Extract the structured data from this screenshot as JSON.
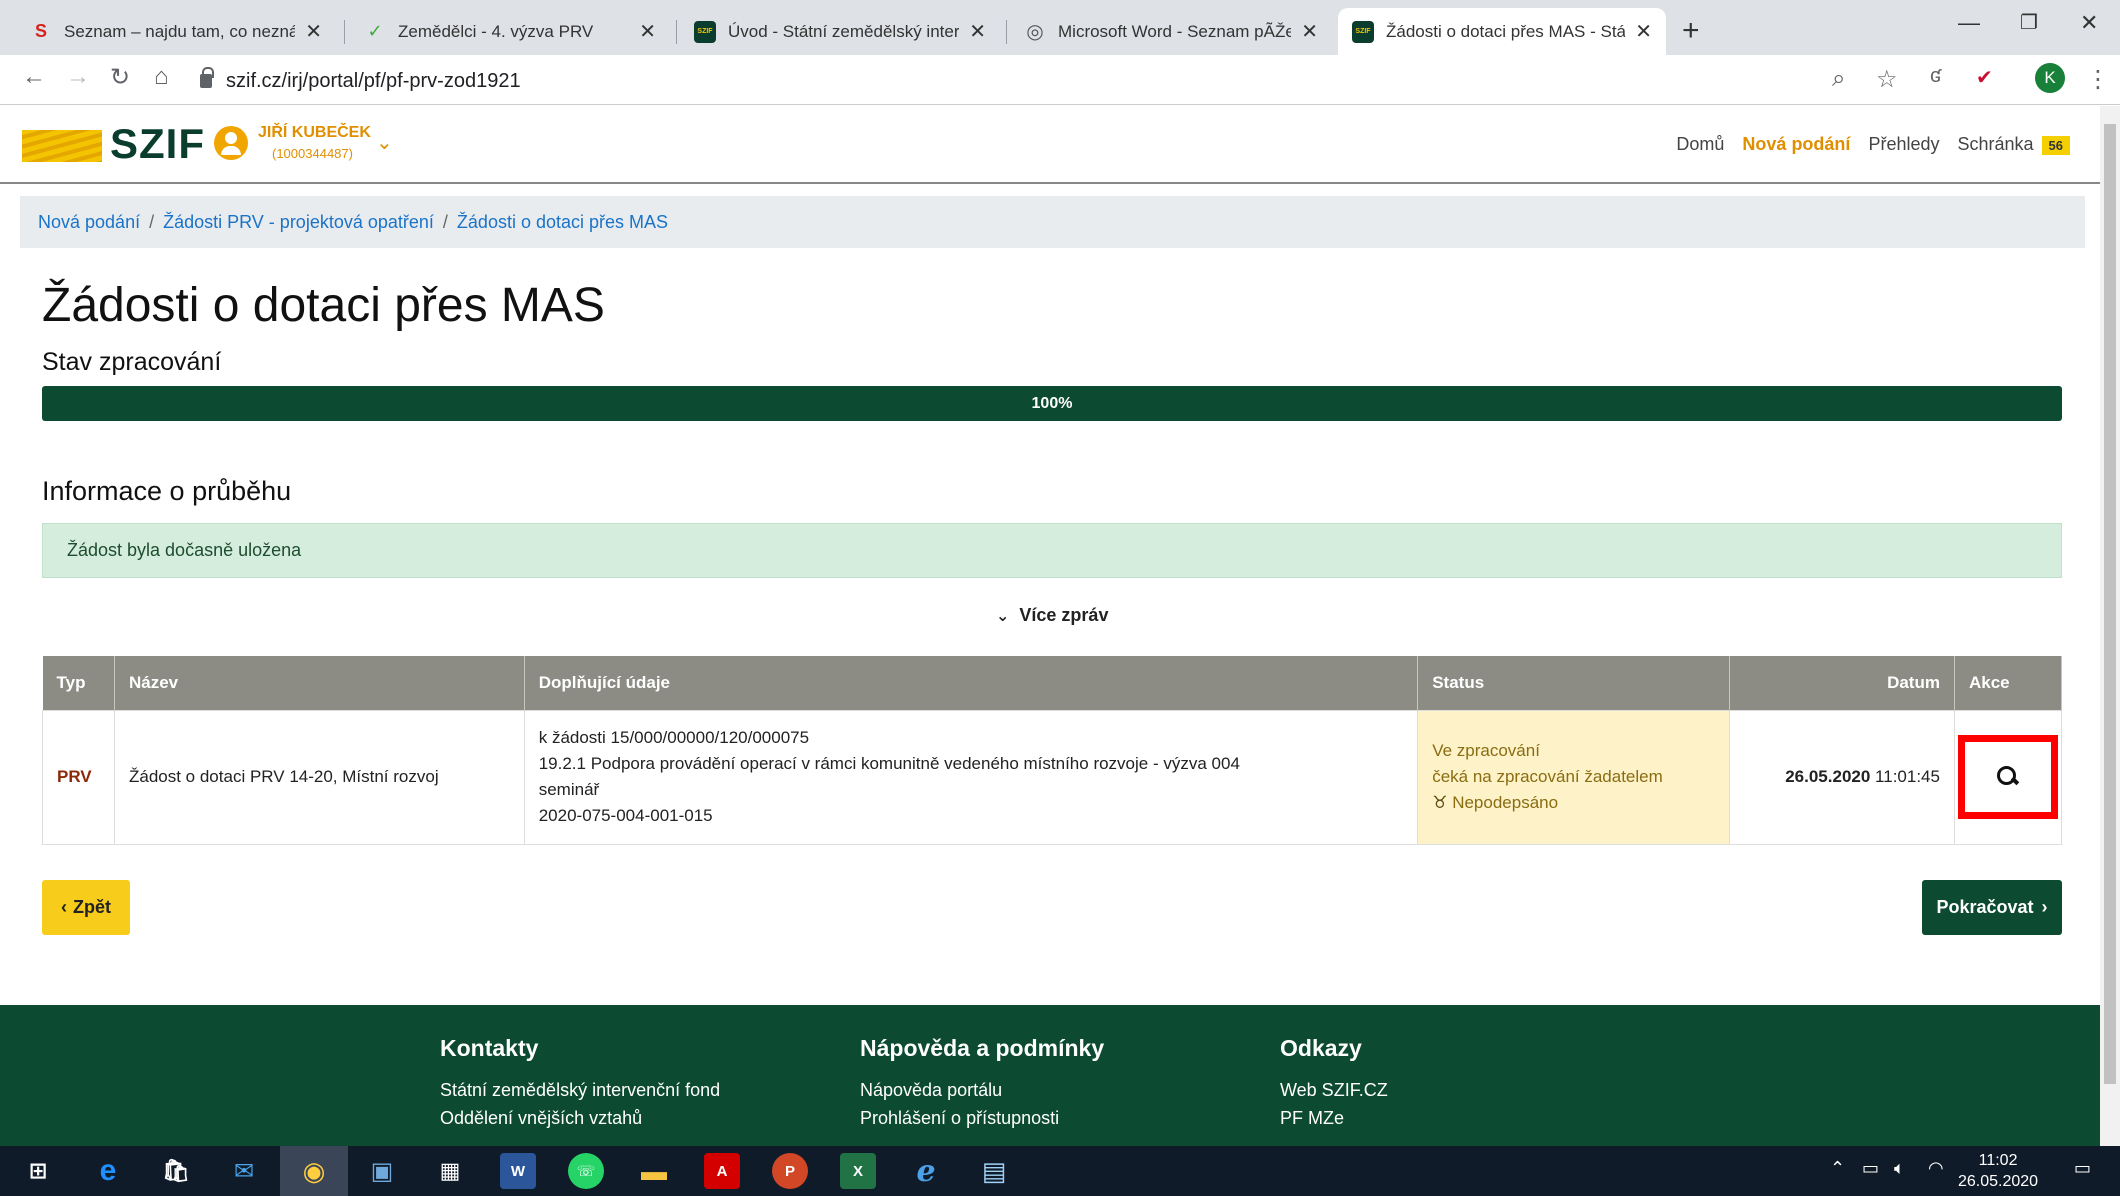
{
  "browser": {
    "tabs": [
      {
        "title": "Seznam – najdu tam, co neznám",
        "icon": "S",
        "icon_color": "#d7231b",
        "icon_bg": "#fff"
      },
      {
        "title": "Zemědělci - 4. výzva PRV",
        "icon": "✓",
        "icon_color": "#3fa83a",
        "icon_bg": "#fff"
      },
      {
        "title": "Úvod - Státní zemědělský interve",
        "icon": "SZIF",
        "icon_color": "#f5c400",
        "icon_bg": "#0b3d2e"
      },
      {
        "title": "Microsoft Word - Seznam pÃŽed",
        "icon": "◎",
        "icon_color": "#555",
        "icon_bg": "#fff"
      },
      {
        "title": "Žádosti o dotaci přes MAS - Státn",
        "icon": "SZIF",
        "icon_color": "#f5c400",
        "icon_bg": "#0b3d2e"
      }
    ],
    "close_glyph": "✕",
    "new_tab": "+",
    "url": "szif.cz/irj/portal/pf/pf-prv-zod1921",
    "profile_initial": "K"
  },
  "header": {
    "logo": "SZIF",
    "user_name": "JIŘÍ KUBEČEK",
    "user_id": "(1000344487)",
    "nav": {
      "home": "Domů",
      "new_submissions": "Nová podání",
      "overviews": "Přehledy",
      "inbox": "Schránka",
      "inbox_count": "56"
    }
  },
  "breadcrumb": {
    "items": [
      "Nová podání",
      "Žádosti PRV - projektová opatření",
      "Žádosti o dotaci přes MAS"
    ],
    "separator": "/"
  },
  "main": {
    "title": "Žádosti o dotaci přes MAS",
    "processing_label": "Stav zpracování",
    "progress_value": 100,
    "progress_text": "100%",
    "info_heading": "Informace o průběhu",
    "alert_text": "Žádost byla dočasně uložena",
    "more_messages": "Více zpráv"
  },
  "table": {
    "headers": {
      "type": "Typ",
      "name": "Název",
      "details": "Doplňující údaje",
      "status": "Status",
      "date": "Datum",
      "action": "Akce"
    },
    "rows": [
      {
        "type": "PRV",
        "name": "Žádost o dotaci PRV 14-20, Místní rozvoj",
        "details": [
          "k žádosti 15/000/00000/120/000075",
          "19.2.1 Podpora provádění operací v rámci komunitně vedeného místního rozvoje - výzva 004",
          "seminář",
          "2020-075-004-001-015"
        ],
        "status_line1": "Ve zpracování",
        "status_line2": "čeká na zpracování žadatelem",
        "status_line3": "Nepodepsáno",
        "date_bold": "26.05.2020",
        "time": "11:01:45"
      }
    ]
  },
  "buttons": {
    "back": "Zpět",
    "continue": "Pokračovat"
  },
  "footer": {
    "columns": [
      {
        "heading": "Kontakty",
        "links": [
          "Státní zemědělský intervenční fond",
          "Oddělení vnějších vztahů"
        ]
      },
      {
        "heading": "Nápověda a podmínky",
        "links": [
          "Nápověda portálu",
          "Prohlášení o přístupnosti"
        ]
      },
      {
        "heading": "Odkazy",
        "links": [
          "Web SZIF.CZ",
          "PF MZe"
        ]
      }
    ]
  },
  "taskbar": {
    "time": "11:02",
    "date": "26.05.2020"
  },
  "colors": {
    "brand_green": "#0c4a31",
    "brand_yellow": "#f7cc1a",
    "accent_orange": "#e08f00",
    "highlight_red": "#ff0000"
  }
}
